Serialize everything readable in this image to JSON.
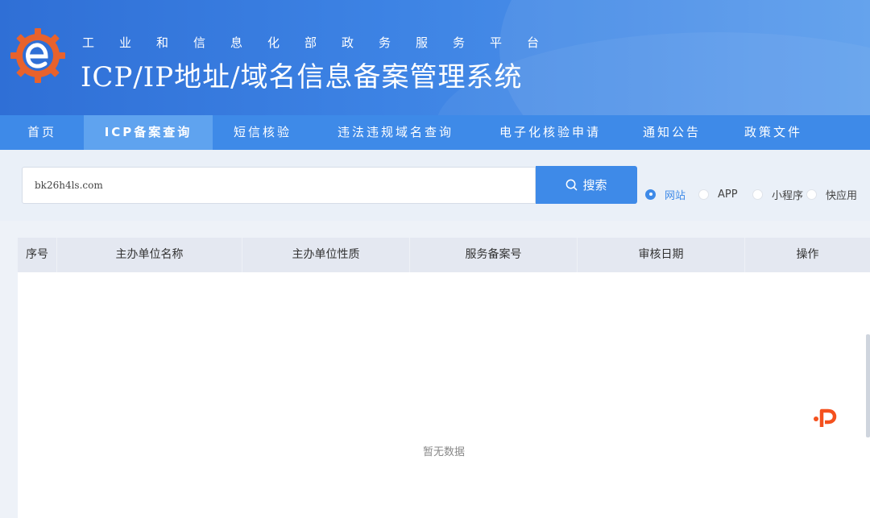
{
  "header": {
    "subtitle": "工业和信息化部政务服务平台",
    "title": "ICP/IP地址/域名信息备案管理系统"
  },
  "nav": {
    "items": [
      {
        "label": "首页",
        "active": false
      },
      {
        "label": "ICP备案查询",
        "active": true
      },
      {
        "label": "短信核验",
        "active": false
      },
      {
        "label": "违法违规域名查询",
        "active": false
      },
      {
        "label": "电子化核验申请",
        "active": false
      },
      {
        "label": "通知公告",
        "active": false
      },
      {
        "label": "政策文件",
        "active": false
      }
    ]
  },
  "search": {
    "value": "bk26h4ls.com",
    "button_label": "搜索",
    "options": [
      {
        "label": "网站",
        "checked": true
      },
      {
        "label": "APP",
        "checked": false
      },
      {
        "label": "小程序",
        "checked": false
      },
      {
        "label": "快应用",
        "checked": false
      }
    ]
  },
  "table": {
    "columns": [
      "序号",
      "主办单位名称",
      "主办单位性质",
      "服务备案号",
      "审核日期",
      "操作"
    ],
    "empty_text": "暂无数据"
  },
  "colors": {
    "primary": "#3e8ae8",
    "nav_active": "#5fa3ef",
    "header_bg": "#2f6fd6",
    "logo_orange": "#e8622c",
    "watermark": "#f4511e"
  },
  "icons": {
    "logo": "gear-e-logo-icon",
    "search": "search-icon",
    "watermark": "p-watermark-icon"
  }
}
